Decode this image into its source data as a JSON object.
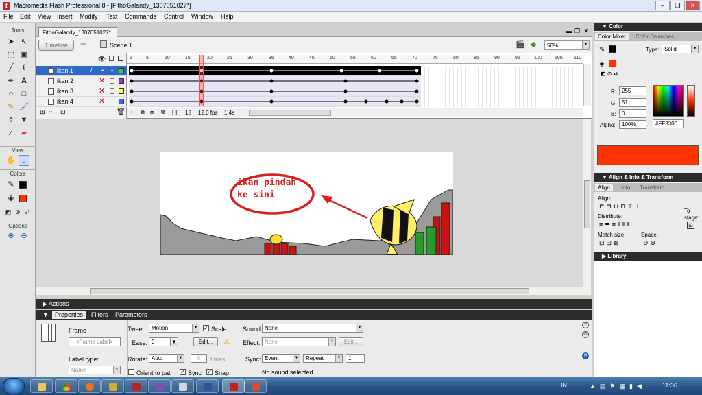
{
  "window": {
    "title": "Macromedia Flash Professional 8 - [FithoGalandy_1307051027*]",
    "app_icon_letter": "f",
    "min": "–",
    "max": "❐",
    "close": "✕"
  },
  "menu": [
    "File",
    "Edit",
    "View",
    "Insert",
    "Modify",
    "Text",
    "Commands",
    "Control",
    "Window",
    "Help"
  ],
  "tools": {
    "label": "Tools",
    "view_label": "View",
    "colors_label": "Colors",
    "options_label": "Options"
  },
  "document": {
    "tab": "FithoGalandy_1307051027*",
    "timeline_button": "Timeline",
    "scene": "Scene 1",
    "zoom": "50%"
  },
  "timeline": {
    "ruler": [
      "1",
      "5",
      "10",
      "15",
      "20",
      "25",
      "30",
      "35",
      "40",
      "45",
      "50",
      "55",
      "60",
      "65",
      "70",
      "75",
      "80",
      "85",
      "90",
      "95",
      "100",
      "105",
      "110"
    ],
    "layers": [
      {
        "name": "ikan 1",
        "selected": true,
        "color": "#33cc33"
      },
      {
        "name": "ikan 2",
        "selected": false,
        "color": "#9933cc"
      },
      {
        "name": "ikan 3",
        "selected": false,
        "color": "#ffff33"
      },
      {
        "name": "ikan 4",
        "selected": false,
        "color": "#3366ff"
      }
    ],
    "current_frame": "18",
    "fps": "12.0 fps",
    "time": "1.4s"
  },
  "stage": {
    "callout_line1": "ikan pindah",
    "callout_line2": "ke sini"
  },
  "panels": {
    "actions": "Actions",
    "tabs": [
      "Properties",
      "Filters",
      "Parameters"
    ],
    "frame_label": "Frame",
    "frame_label_placeholder": "<Frame Label>",
    "label_type": "Label type:",
    "label_type_value": "Name",
    "tween_label": "Tween:",
    "tween_value": "Motion",
    "scale": "Scale",
    "ease_label": "Ease:",
    "ease_value": "0",
    "edit_button": "Edit...",
    "rotate_label": "Rotate:",
    "rotate_value": "Auto",
    "rotate_times": "0",
    "times": "times",
    "orient": "Orient to path",
    "sync": "Sync",
    "snap": "Snap",
    "sound_label": "Sound:",
    "sound_value": "None",
    "effect_label": "Effect:",
    "effect_value": "None",
    "effect_edit": "Edit...",
    "sync_label": "Sync:",
    "sync_value": "Event",
    "repeat_value": "Repeat",
    "repeat_count": "1",
    "no_sound": "No sound selected"
  },
  "color_panel": {
    "header": "Color",
    "tab_mixer": "Color Mixer",
    "tab_swatches": "Color Swatches",
    "type_label": "Type:",
    "type_value": "Solid",
    "r_label": "R:",
    "r": "255",
    "g_label": "G:",
    "g": "51",
    "b_label": "B:",
    "b": "0",
    "alpha_label": "Alpha:",
    "alpha": "100%",
    "hex": "#FF3300",
    "fill_color": "#ff3300"
  },
  "align_panel": {
    "header": "Align & Info & Transform",
    "tab_align": "Align",
    "tab_info": "Info",
    "tab_transform": "Transform",
    "align": "Align:",
    "distribute": "Distribute:",
    "match_size": "Match size:",
    "space": "Space:",
    "to_stage_1": "To",
    "to_stage_2": "stage:"
  },
  "library_panel": {
    "header": "Library"
  },
  "taskbar": {
    "lang": "IN",
    "clock": "11:36"
  }
}
